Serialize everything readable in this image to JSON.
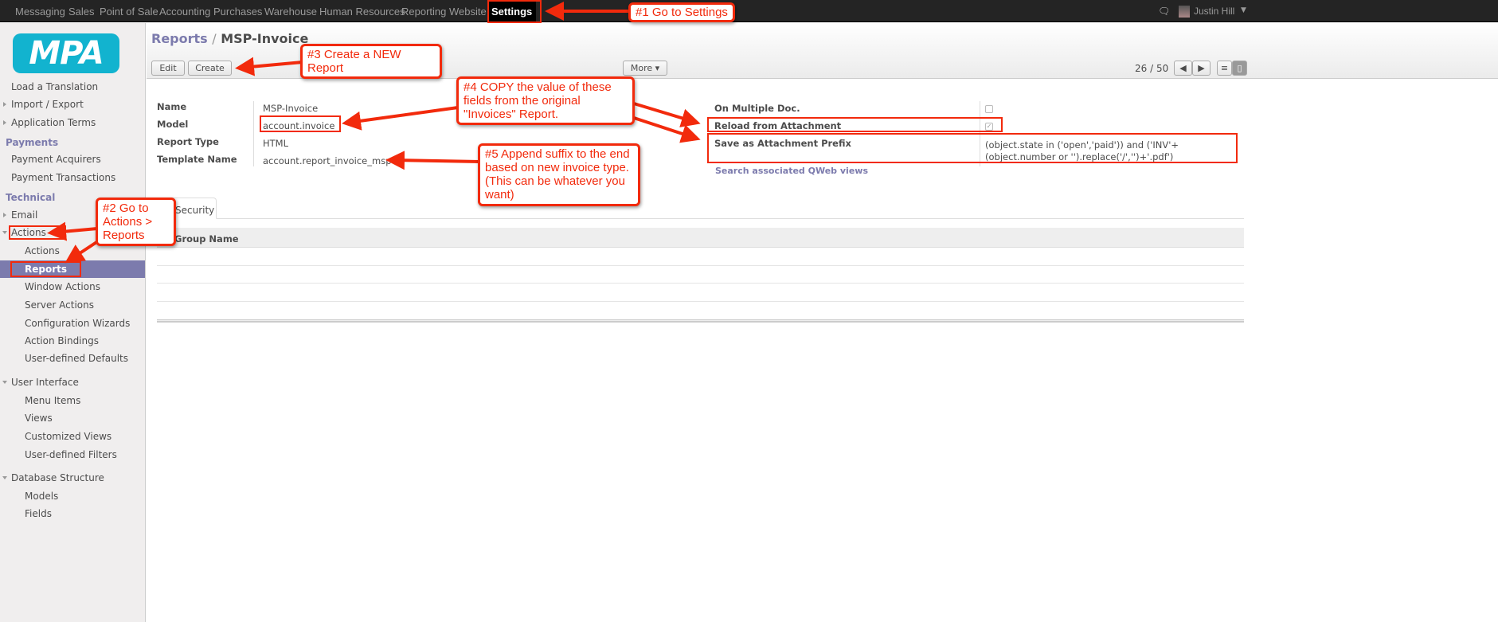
{
  "topbar": {
    "menus": [
      "Messaging",
      "Sales",
      "Point of Sale",
      "Accounting",
      "Purchases",
      "Warehouse",
      "Human Resources",
      "Reporting",
      "Website",
      "Settings"
    ],
    "active": "Settings",
    "user": "Justin Hill"
  },
  "logo": {
    "text": "MPA",
    "color": "#12b3cf"
  },
  "sidebar": {
    "items": [
      {
        "label": "Load a Translation",
        "type": "l1"
      },
      {
        "label": "Import / Export",
        "type": "l1",
        "arrow": "right"
      },
      {
        "label": "Application Terms",
        "type": "l1",
        "arrow": "right"
      },
      {
        "label": "Payments",
        "type": "hdr"
      },
      {
        "label": "Payment Acquirers",
        "type": "l1"
      },
      {
        "label": "Payment Transactions",
        "type": "l1"
      },
      {
        "label": "Technical",
        "type": "hdr"
      },
      {
        "label": "Email",
        "type": "l1",
        "arrow": "right"
      },
      {
        "label": "Actions",
        "type": "l1",
        "arrow": "down"
      },
      {
        "label": "Actions",
        "type": "l2"
      },
      {
        "label": "Reports",
        "type": "l2",
        "selected": true
      },
      {
        "label": "Window Actions",
        "type": "l2"
      },
      {
        "label": "Server Actions",
        "type": "l2"
      },
      {
        "label": "Configuration Wizards",
        "type": "l2"
      },
      {
        "label": "Action Bindings",
        "type": "l2"
      },
      {
        "label": "User-defined Defaults",
        "type": "l2"
      },
      {
        "label": "User Interface",
        "type": "l1",
        "arrow": "down"
      },
      {
        "label": "Menu Items",
        "type": "l2"
      },
      {
        "label": "Views",
        "type": "l2"
      },
      {
        "label": "Customized Views",
        "type": "l2"
      },
      {
        "label": "User-defined Filters",
        "type": "l2"
      },
      {
        "label": "Database Structure",
        "type": "l1",
        "arrow": "down"
      },
      {
        "label": "Models",
        "type": "l2"
      },
      {
        "label": "Fields",
        "type": "l2"
      }
    ]
  },
  "breadcrumb": {
    "parent": "Reports",
    "separator": "/",
    "current": "MSP-Invoice"
  },
  "toolbar": {
    "edit": "Edit",
    "create": "Create",
    "more": "More ▾",
    "pager": "26 / 50"
  },
  "form": {
    "left": [
      {
        "label": "Name",
        "value": "MSP-Invoice"
      },
      {
        "label": "Model",
        "value": "account.invoice"
      },
      {
        "label": "Report Type",
        "value": "HTML"
      },
      {
        "label": "Template Name",
        "value": "account.report_invoice_msp"
      }
    ],
    "right": [
      {
        "label": "On Multiple Doc.",
        "checked": false
      },
      {
        "label": "Reload from Attachment",
        "checked": true
      },
      {
        "label": "Save as Attachment Prefix",
        "value": "(object.state in ('open','paid')) and ('INV'+(object.number or '').replace('/','')+'.pdf')"
      }
    ],
    "link": "Search associated QWeb views"
  },
  "tabs": {
    "security": "Security",
    "column": "Group Name"
  },
  "annotations": {
    "a1": "#1 Go to Settings",
    "a2": "#2 Go to Actions > Reports",
    "a3": "#3 Create a NEW Report",
    "a4": "#4 COPY the value of these fields from the original \"Invoices\" Report.",
    "a5": "#5 Append suffix to the end based on new invoice type. (This can be whatever you want)"
  },
  "colors": {
    "accent": "#7c7bad",
    "annotation": "#f22a0c",
    "topbar": "#242424"
  }
}
